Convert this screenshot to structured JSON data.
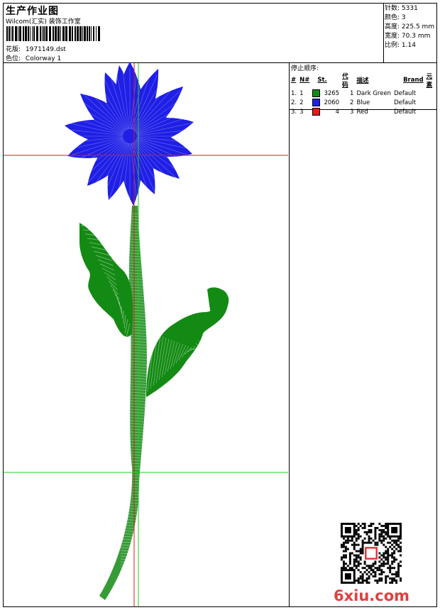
{
  "header": {
    "title": "生产作业图",
    "company": "Wilcom(汇实) 装饰工作室",
    "design_label": "花版:",
    "design_value": "1971149.dst",
    "colorway_label": "色位:",
    "colorway_value": "Colorway 1"
  },
  "stats": [
    {
      "label": "针数:",
      "value": "5331"
    },
    {
      "label": "颜色:",
      "value": "3"
    },
    {
      "label": "高度:",
      "value": "225.5 mm"
    },
    {
      "label": "宽度:",
      "value": "70.3 mm"
    },
    {
      "label": "比例:",
      "value": "1.14"
    }
  ],
  "stop_sequence": {
    "title": "停止顺序:",
    "columns": [
      "#",
      "N#",
      "St.",
      "代码",
      "描述",
      "Brand",
      "元素"
    ],
    "rows": [
      {
        "n": "1.",
        "nn": "1",
        "color": "#138a13",
        "stitches": "3265",
        "code": "1",
        "desc": "Dark Green",
        "brand": "Default"
      },
      {
        "n": "2.",
        "nn": "2",
        "color": "#1f1fe6",
        "stitches": "2060",
        "code": "2",
        "desc": "Blue",
        "brand": "Default"
      },
      {
        "n": "3.",
        "nn": "3",
        "color": "#e01a1a",
        "stitches": "4",
        "code": "3",
        "desc": "Red",
        "brand": "Default"
      }
    ]
  },
  "guides": {
    "labels": [
      "1",
      "2",
      "1",
      "2"
    ],
    "colors": {
      "red": "#e01a1a",
      "green": "#1ecc1e"
    }
  },
  "design": {
    "colors": {
      "stem": "#138a13",
      "flower": "#1f1fe6"
    }
  },
  "watermark": "6xiu.com"
}
